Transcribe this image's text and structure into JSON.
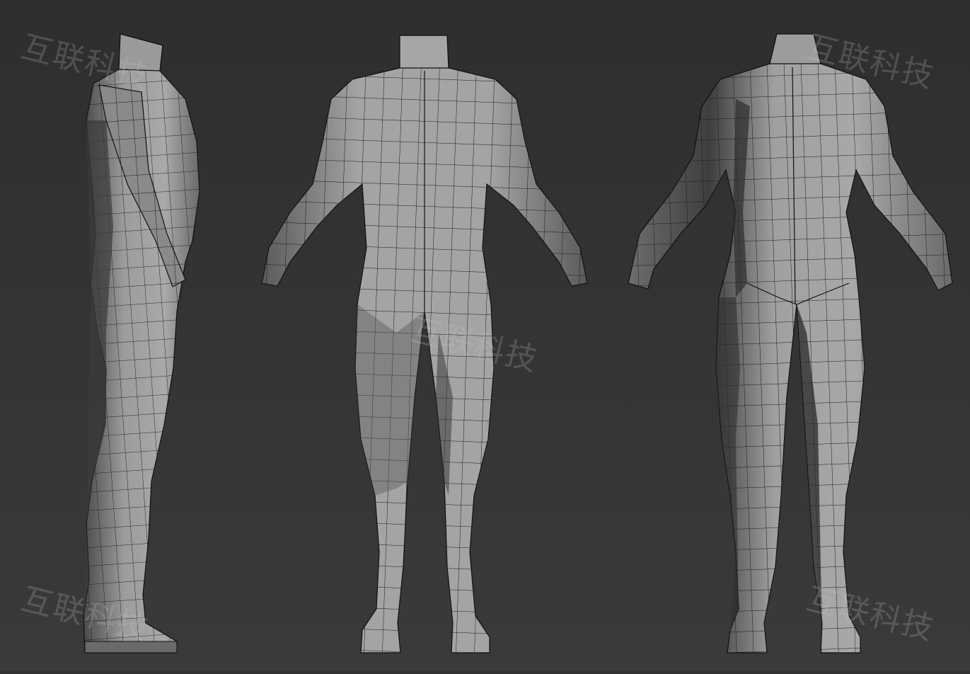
{
  "scene": {
    "views": [
      "side",
      "back",
      "front"
    ],
    "colors": {
      "background_top": "#2e2e2e",
      "background_bottom": "#3a3a3a",
      "mesh_light": "#a9a9a9",
      "mesh_mid": "#8c8c8c",
      "mesh_dark": "#4a4a4a",
      "wire": "#1a1a1a"
    }
  },
  "watermark": {
    "text": "互联科技"
  }
}
